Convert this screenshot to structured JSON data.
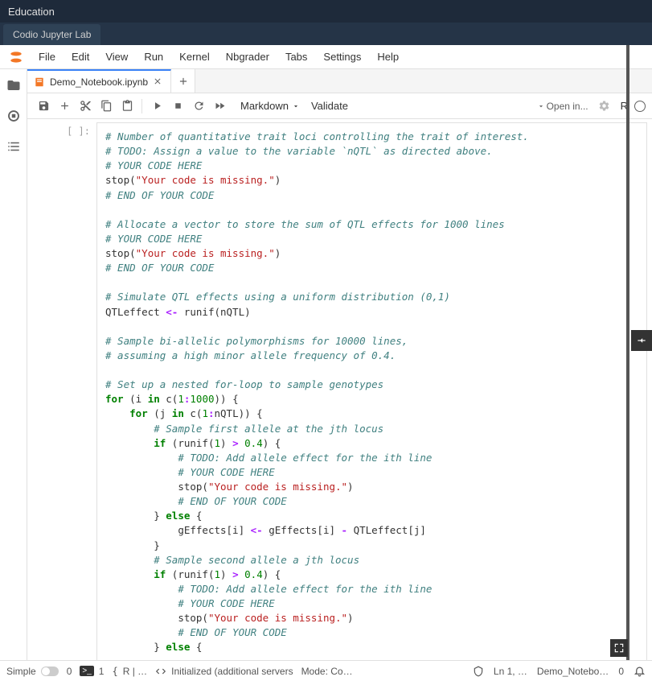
{
  "titlebar": {
    "label": "Education"
  },
  "codio": {
    "tab_label": "Codio Jupyter Lab"
  },
  "menu": {
    "items": [
      "File",
      "Edit",
      "View",
      "Run",
      "Kernel",
      "Nbgrader",
      "Tabs",
      "Settings",
      "Help"
    ]
  },
  "tabs": {
    "active_label": "Demo_Notebook.ipynb"
  },
  "toolbar": {
    "cell_type": "Markdown",
    "validate_label": "Validate",
    "open_in_label": "Open in...",
    "kernel_label": "R"
  },
  "cell": {
    "prompt": "[ ]:",
    "lines": [
      {
        "t": "comment",
        "s": "# Number of quantitative trait loci controlling the trait of interest."
      },
      {
        "t": "comment",
        "s": "# TODO: Assign a value to the variable `nQTL` as directed above."
      },
      {
        "t": "comment",
        "s": "# YOUR CODE HERE"
      },
      {
        "t": "stop",
        "s": "Your code is missing."
      },
      {
        "t": "comment",
        "s": "# END OF YOUR CODE"
      },
      {
        "t": "blank"
      },
      {
        "t": "comment",
        "s": "# Allocate a vector to store the sum of QTL effects for 1000 lines"
      },
      {
        "t": "comment",
        "s": "# YOUR CODE HERE"
      },
      {
        "t": "stop",
        "s": "Your code is missing."
      },
      {
        "t": "comment",
        "s": "# END OF YOUR CODE"
      },
      {
        "t": "blank"
      },
      {
        "t": "comment",
        "s": "# Simulate QTL effects using a uniform distribution (0,1)"
      },
      {
        "t": "assign_runif"
      },
      {
        "t": "blank"
      },
      {
        "t": "comment",
        "s": "# Sample bi-allelic polymorphisms for 10000 lines,"
      },
      {
        "t": "comment",
        "s": "# assuming a high minor allele frequency of 0.4."
      },
      {
        "t": "blank"
      },
      {
        "t": "comment",
        "s": "# Set up a nested for-loop to sample genotypes"
      },
      {
        "t": "for_i"
      },
      {
        "t": "for_j",
        "indent": 1
      },
      {
        "t": "comment",
        "s": "# Sample first allele at the jth locus",
        "indent": 2
      },
      {
        "t": "if_runif",
        "indent": 2
      },
      {
        "t": "comment",
        "s": "# TODO: Add allele effect for the ith line",
        "indent": 3
      },
      {
        "t": "comment",
        "s": "# YOUR CODE HERE",
        "indent": 3
      },
      {
        "t": "stop",
        "s": "Your code is missing.",
        "indent": 3
      },
      {
        "t": "comment",
        "s": "# END OF YOUR CODE",
        "indent": 3
      },
      {
        "t": "else",
        "indent": 2
      },
      {
        "t": "geff_minus",
        "indent": 3
      },
      {
        "t": "close",
        "indent": 2
      },
      {
        "t": "comment",
        "s": "# Sample second allele a jth locus",
        "indent": 2
      },
      {
        "t": "if_runif",
        "indent": 2
      },
      {
        "t": "comment",
        "s": "# TODO: Add allele effect for the ith line",
        "indent": 3
      },
      {
        "t": "comment",
        "s": "# YOUR CODE HERE",
        "indent": 3
      },
      {
        "t": "stop",
        "s": "Your code is missing.",
        "indent": 3
      },
      {
        "t": "comment",
        "s": "# END OF YOUR CODE",
        "indent": 3
      },
      {
        "t": "else",
        "indent": 2
      }
    ]
  },
  "status": {
    "simple": "Simple",
    "zero1": "0",
    "one": "1",
    "tab_info": "R | …",
    "init": "Initialized (additional servers",
    "mode": "Mode: Co…",
    "ln": "Ln 1, …",
    "nb_name": "Demo_Notebo…",
    "zero2": "0"
  }
}
